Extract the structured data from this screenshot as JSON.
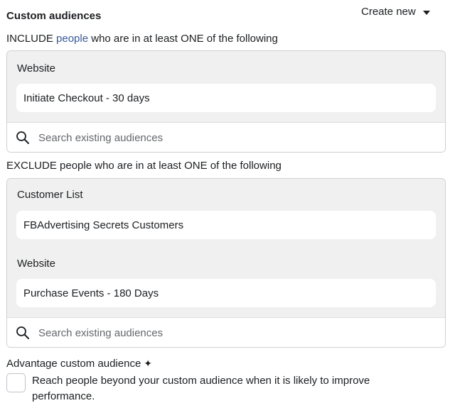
{
  "header": {
    "title": "Custom audiences",
    "create_new": "Create new"
  },
  "include": {
    "label_prefix": "INCLUDE ",
    "label_link": "people",
    "label_suffix": " who are in at least ONE of the following",
    "groups": [
      {
        "label": "Website",
        "items": [
          "Initiate Checkout - 30 days"
        ]
      }
    ],
    "search_placeholder": "Search existing audiences"
  },
  "exclude": {
    "label": "EXCLUDE people who are in at least ONE of the following",
    "groups": [
      {
        "label": "Customer List",
        "items": [
          "FBAdvertising Secrets Customers"
        ]
      },
      {
        "label": "Website",
        "items": [
          "Purchase Events - 180 Days"
        ]
      }
    ],
    "search_placeholder": "Search existing audiences"
  },
  "advantage": {
    "label": "Advantage custom audience",
    "icon": "sparkle-icon",
    "checked": false,
    "description": "Reach people beyond your custom audience when it is likely to improve performance."
  }
}
